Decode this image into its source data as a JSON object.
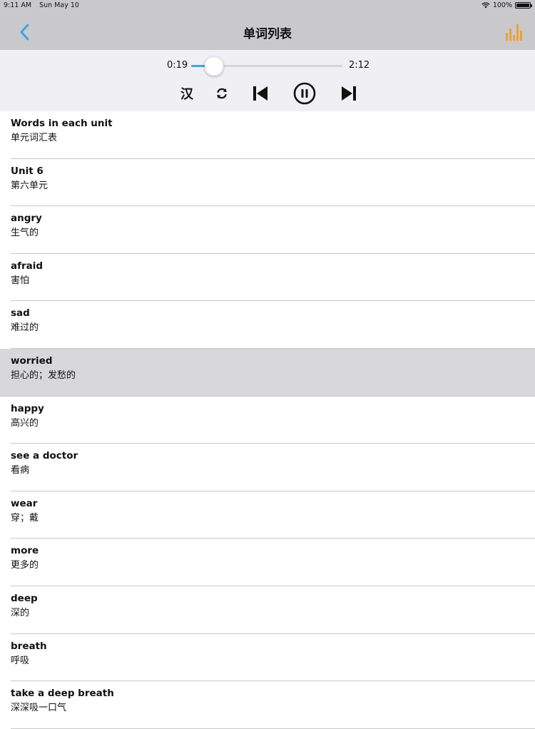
{
  "status": {
    "time": "9:11 AM",
    "date": "Sun May 10",
    "battery": "100%"
  },
  "nav": {
    "title": "单词列表",
    "back_icon": "chevron-left-icon",
    "chart_icon": "bar-chart-icon",
    "accent": "#3aa6e8",
    "chart_color": "#f0a030"
  },
  "player": {
    "current_time": "0:19",
    "total_time": "2:12",
    "progress": 0.15,
    "han_label": "汉",
    "loop_icon": "repeat-icon",
    "prev_icon": "skip-previous-icon",
    "pause_icon": "pause-icon",
    "next_icon": "skip-next-icon"
  },
  "words": [
    {
      "word": "Words in each unit",
      "meaning": "单元词汇表"
    },
    {
      "word": "Unit 6",
      "meaning": "第六单元"
    },
    {
      "word": "angry",
      "meaning": "生气的"
    },
    {
      "word": "afraid",
      "meaning": "害怕"
    },
    {
      "word": "sad",
      "meaning": "难过的"
    },
    {
      "word": "worried",
      "meaning": "担心的；发愁的",
      "selected": true
    },
    {
      "word": "happy",
      "meaning": "高兴的"
    },
    {
      "word": "see a doctor",
      "meaning": "看病"
    },
    {
      "word": "wear",
      "meaning": "穿；戴"
    },
    {
      "word": "more",
      "meaning": "更多的"
    },
    {
      "word": "deep",
      "meaning": "深的"
    },
    {
      "word": "breath",
      "meaning": "呼吸"
    },
    {
      "word": "take a deep breath",
      "meaning": "深深吸一口气"
    }
  ]
}
